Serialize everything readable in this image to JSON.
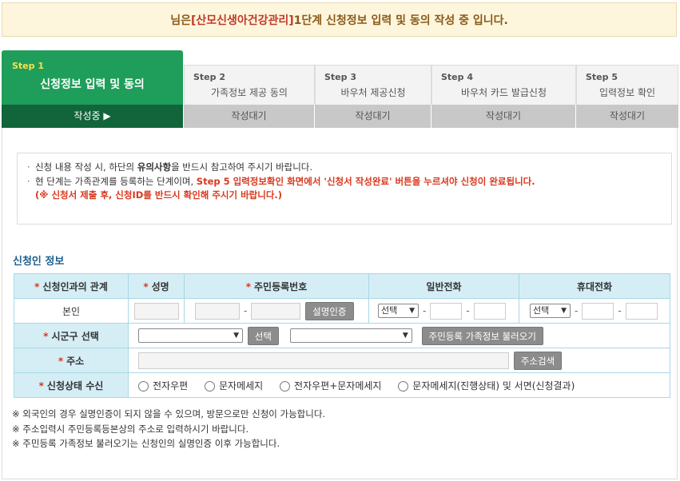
{
  "banner": {
    "prefix": "님은 ",
    "app_name": "[산모신생아건강관리]",
    "suffix": " 1단계 신청정보 입력 및 동의 작성 중 입니다."
  },
  "steps": [
    {
      "num": "Step 1",
      "title": "신청정보 입력 및 동의",
      "status": "작성중"
    },
    {
      "num": "Step 2",
      "title": "가족정보 제공 동의",
      "status": "작성대기"
    },
    {
      "num": "Step 3",
      "title": "바우처 제공신청",
      "status": "작성대기"
    },
    {
      "num": "Step 4",
      "title": "바우처 카드 발급신청",
      "status": "작성대기"
    },
    {
      "num": "Step 5",
      "title": "입력정보 확인",
      "status": "작성대기"
    }
  ],
  "notice": {
    "line1_a": "신청 내용 작성 시, 하단의 ",
    "line1_b": "유의사항",
    "line1_c": "을 반드시 참고하여 주시기 바랍니다.",
    "line2_a": "현 단계는 가족관계를 등록하는 단계이며, ",
    "line2_b": "Step 5 입력정보확인 화면에서 '신청서 작성완료' 버튼을 누르셔야 신청이 완료됩니다.",
    "line3": "(※ 신청서 제출 후, 신청ID를 반드시 확인해 주시기 바랍니다.)"
  },
  "section_title": "신청인 정보",
  "table": {
    "headers": [
      "신청인과의 관계",
      "성명",
      "주민등록번호",
      "일반전화",
      "휴대전화"
    ],
    "relation_value": "본인",
    "verify_button": "설명인증",
    "phone_select": "선택",
    "mobile_select": "선택",
    "region_label": "시군구 선택",
    "select_button": "선택",
    "load_family_button": "주민등록 가족정보 불러오기",
    "address_label": "주소",
    "address_search_button": "주소검색",
    "receive_label": "신청상태 수신",
    "receive_options": [
      "전자우편",
      "문자메세지",
      "전자우편+문자메세지",
      "문자메세지(진행상태) 및 서면(신청결과)"
    ]
  },
  "footnotes": [
    "※ 외국인의 경우 실명인증이 되지 않을 수 있으며, 방문으로만 신청이 가능합니다.",
    "※ 주소입력시 주민등록등본상의 주소로 입력하시기 바랍니다.",
    "※ 주민등록 가족정보 불러오기는 신청인의 실명인증 이후 가능합니다."
  ],
  "colors": {
    "active_step": "#1f9d5a",
    "active_status": "#12643a",
    "header_cell": "#d5eef5",
    "accent_red": "#d9381e"
  }
}
